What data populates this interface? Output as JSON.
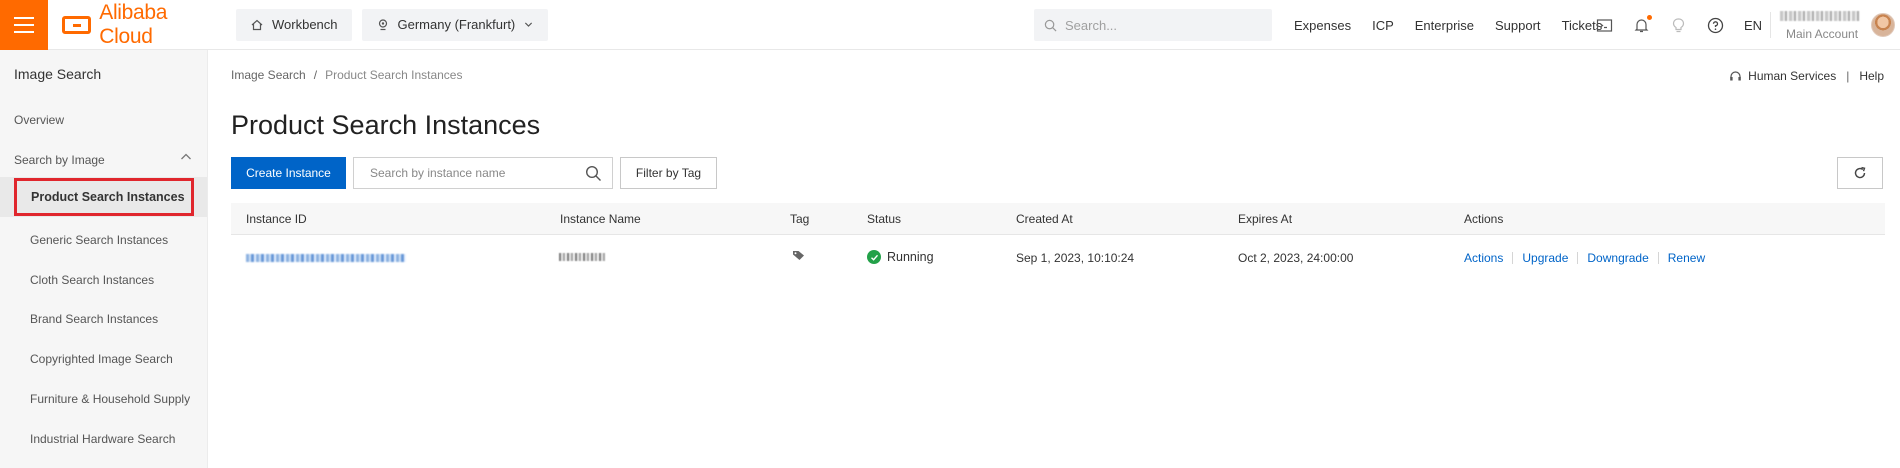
{
  "topbar": {
    "brand": "Alibaba Cloud",
    "workbench": "Workbench",
    "region": "Germany (Frankfurt)",
    "search_placeholder": "Search...",
    "links": [
      "Expenses",
      "ICP",
      "Enterprise",
      "Support",
      "Tickets"
    ],
    "language": "EN",
    "account_type": "Main Account",
    "accent_color": "#ff6a00"
  },
  "sidebar": {
    "title": "Image Search",
    "overview": "Overview",
    "group": "Search by Image",
    "items": [
      "Product Search Instances",
      "Generic Search Instances",
      "Cloth Search Instances",
      "Brand Search Instances",
      "Copyrighted Image Search",
      "Furniture & Household Supply",
      "Industrial Hardware Search"
    ],
    "active_item": "Product Search Instances"
  },
  "main": {
    "breadcrumb": [
      "Image Search",
      "/",
      "Product Search Instances"
    ],
    "human_services": "Human Services",
    "help_sep": "|",
    "help": "Help",
    "title": "Product Search Instances",
    "create_button": "Create Instance",
    "search_placeholder": "Search by instance name",
    "filter_button": "Filter by Tag",
    "primary_color": "#0064c8"
  },
  "table": {
    "columns": [
      "Instance ID",
      "Instance Name",
      "Tag",
      "Status",
      "Created At",
      "Expires At",
      "Actions"
    ],
    "rows": [
      {
        "status": "Running",
        "created_at": "Sep 1, 2023, 10:10:24",
        "expires_at": "Oct 2, 2023, 24:00:00",
        "actions": [
          "Actions",
          "Upgrade",
          "Downgrade",
          "Renew"
        ]
      }
    ],
    "status_color": "#23a149"
  }
}
